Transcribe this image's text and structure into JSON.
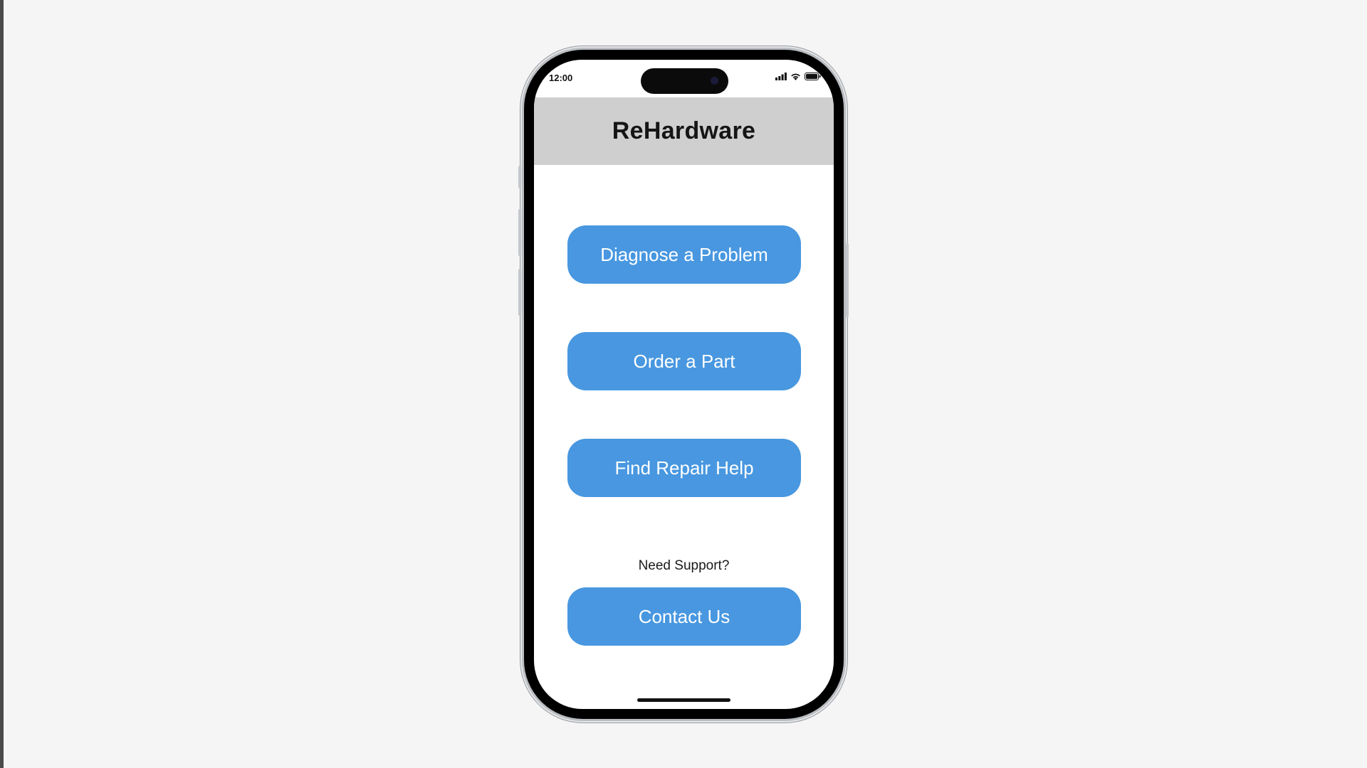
{
  "status_bar": {
    "time": "12:00",
    "icons": [
      "cellular-signal-icon",
      "wifi-icon",
      "battery-icon"
    ]
  },
  "app": {
    "title": "ReHardware"
  },
  "actions": {
    "diagnose_label": "Diagnose a Problem",
    "order_label": "Order a Part",
    "repair_label": "Find Repair Help"
  },
  "support": {
    "prompt": "Need Support?",
    "contact_label": "Contact Us"
  },
  "colors": {
    "accent": "#4897e0",
    "header_bg": "#cfcfcf",
    "page_bg": "#f5f5f5"
  }
}
